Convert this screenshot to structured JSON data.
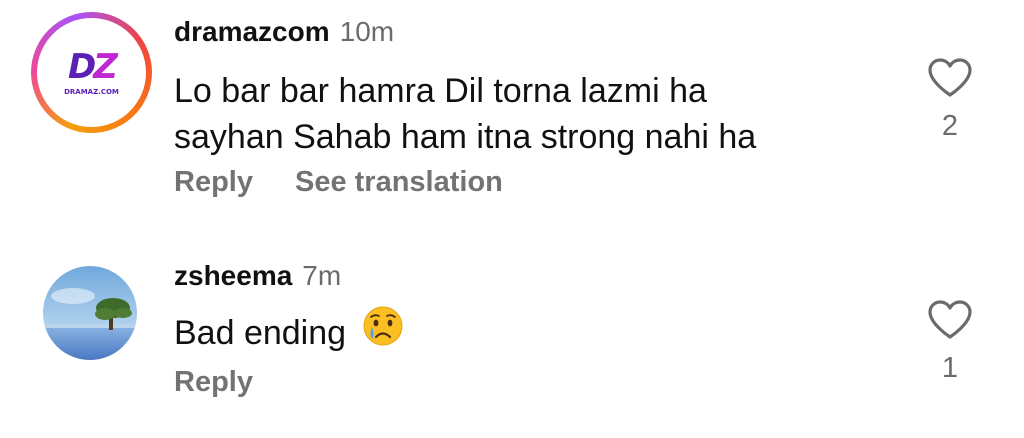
{
  "comments": [
    {
      "username": "dramazcom",
      "time": "10m",
      "text_lines": [
        "Lo bar bar hamra Dil torna lazmi ha",
        "sayhan Sahab ham itna strong nahi ha"
      ],
      "reply_label": "Reply",
      "translate_label": "See translation",
      "like_count": "2",
      "avatar": {
        "logo_letters": [
          "D",
          "Z"
        ],
        "logo_domain": "DRAMAZ.COM",
        "brand_color": "#5b21b6"
      }
    },
    {
      "username": "zsheema",
      "time": "7m",
      "text": "Bad ending",
      "emoji_icon": "crying-face-icon",
      "reply_label": "Reply",
      "like_count": "1",
      "avatar": {
        "icon": "landscape-tree-photo"
      }
    }
  ]
}
